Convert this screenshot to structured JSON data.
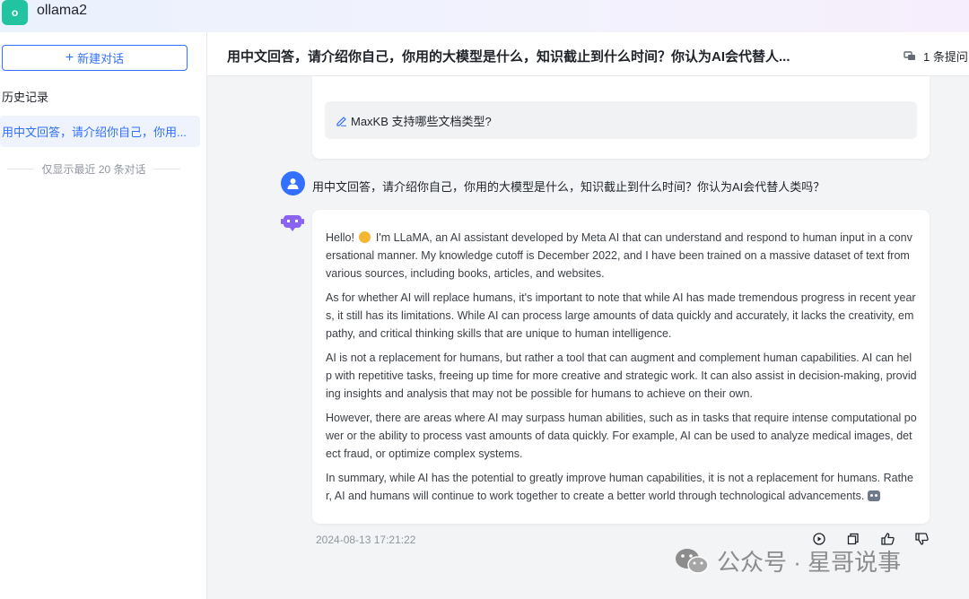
{
  "app": {
    "logo_letter": "o",
    "name": "ollama2"
  },
  "sidebar": {
    "new_chat_label": "新建对话",
    "history_title": "历史记录",
    "history_items": [
      {
        "label": "用中文回答，请介绍你自己，你用..."
      }
    ],
    "history_note": "仅显示最近 20 条对话"
  },
  "chat": {
    "title": "用中文回答，请介绍你自己，你用的大模型是什么，知识截止到什么时间？你认为AI会代替人...",
    "question_count": "1 条提问",
    "suggested_prompt": "MaxKB 支持哪些文档类型?",
    "user_message": "用中文回答，请介绍你自己，你用的大模型是什么，知识截止到什么时间？你认为AI会代替人类吗？",
    "answer": {
      "p1_before_emoji": "Hello! ",
      "p1_after_emoji": " I'm LLaMA, an AI assistant developed by Meta AI that can understand and respond to human input in a conversational manner. My knowledge cutoff is December 2022, and I have been trained on a massive dataset of text from various sources, including books, articles, and websites.",
      "p2": "As for whether AI will replace humans, it's important to note that while AI has made tremendous progress in recent years, it still has its limitations. While AI can process large amounts of data quickly and accurately, it lacks the creativity, empathy, and critical thinking skills that are unique to human intelligence.",
      "p3": "AI is not a replacement for humans, but rather a tool that can augment and complement human capabilities. AI can help with repetitive tasks, freeing up time for more creative and strategic work. It can also assist in decision-making, providing insights and analysis that may not be possible for humans to achieve on their own.",
      "p4": "However, there are areas where AI may surpass human abilities, such as in tasks that require intense computational power or the ability to process vast amounts of data quickly. For example, AI can be used to analyze medical images, detect fraud, or optimize complex systems.",
      "p5": "In summary, while AI has the potential to greatly improve human capabilities, it is not a replacement for humans. Rather, AI and humans will continue to work together to create a better world through technological advancements."
    },
    "timestamp": "2024-08-13 17:21:22",
    "actions": [
      "play-icon",
      "copy-icon",
      "thumbs-up-icon",
      "thumbs-down-icon"
    ]
  },
  "watermark": "公众号 · 星哥说事",
  "colors": {
    "accent": "#3370ff",
    "logo": "#21c3a0"
  }
}
